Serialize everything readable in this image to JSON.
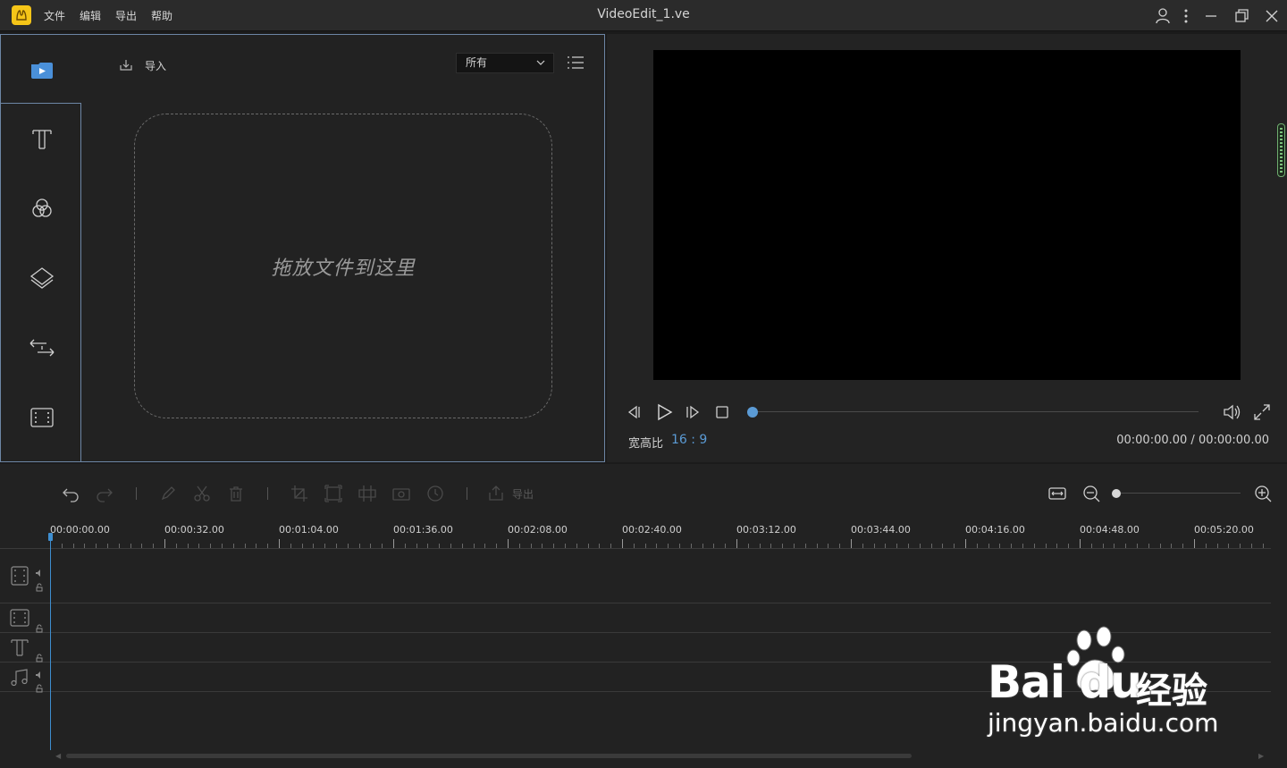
{
  "titlebar": {
    "menu": [
      "文件",
      "编辑",
      "导出",
      "帮助"
    ],
    "title": "VideoEdit_1.ve"
  },
  "media": {
    "import_label": "导入",
    "filter_value": "所有",
    "dropzone_text": "拖放文件到这里"
  },
  "side_nav": {
    "items": [
      "media-icon",
      "text-icon",
      "filter-icon",
      "overlay-icon",
      "transition-icon",
      "film-icon"
    ],
    "selected": 0
  },
  "preview": {
    "aspect_label": "宽高比",
    "aspect_value": "16 : 9",
    "time": "00:00:00.00 / 00:00:00.00",
    "progress": 0
  },
  "timeline": {
    "export_label": "导出",
    "zoom_level": 0,
    "ruler": [
      "00:00:00.00",
      "00:00:32.00",
      "00:01:04.00",
      "00:01:36.00",
      "00:02:08.00",
      "00:02:40.00",
      "00:03:12.00",
      "00:03:44.00",
      "00:04:16.00",
      "00:04:48.00",
      "00:05:20.00"
    ],
    "tracks": [
      "video-track-icon",
      "overlay-track-icon",
      "text-track-icon",
      "music-track-icon"
    ]
  },
  "watermark": {
    "brand": "Bai du",
    "product": "经验",
    "url": "jingyan.baidu.com"
  },
  "colors": {
    "accent": "#5b9bd5",
    "panel": "#222222",
    "titlebar": "#2b2b2b"
  }
}
